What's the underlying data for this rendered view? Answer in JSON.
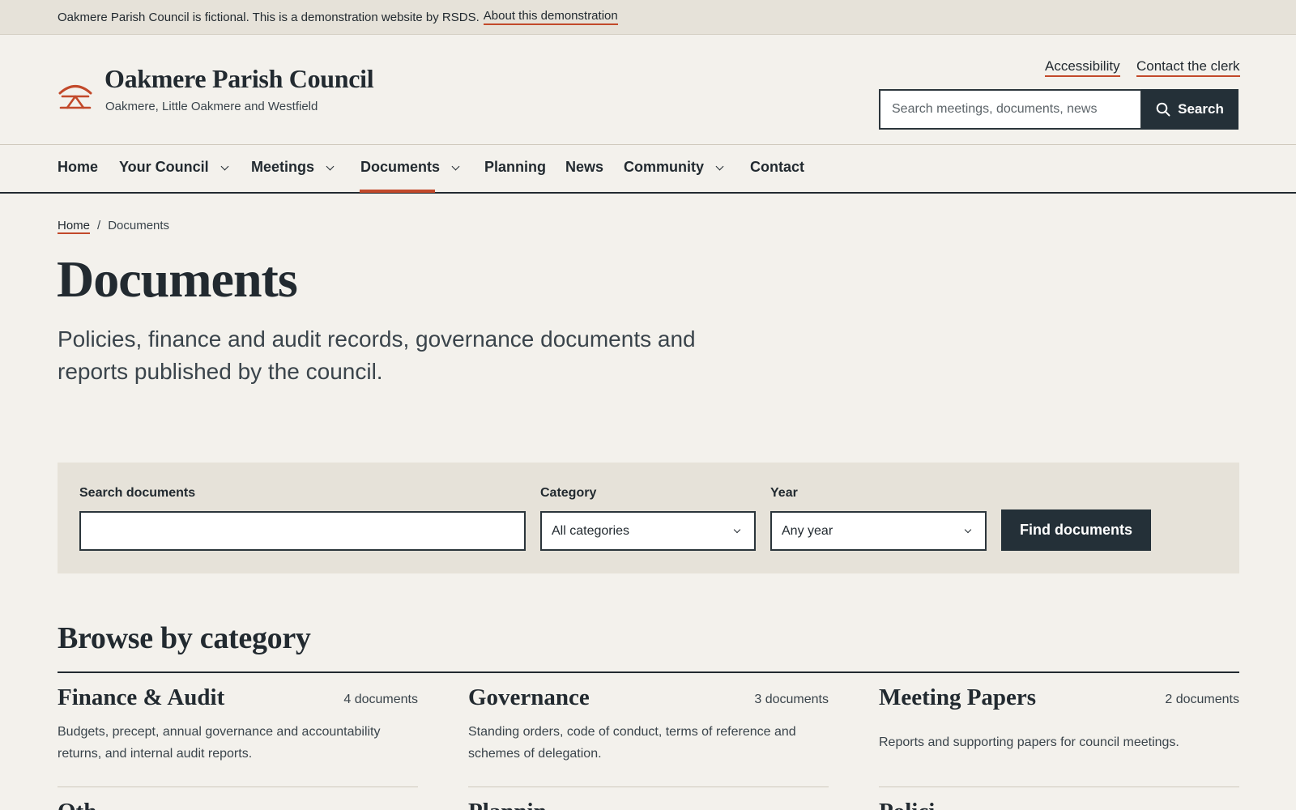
{
  "demo_bar": {
    "text": "Oakmere Parish Council is fictional. This is a demonstration website by RSDS.",
    "link": "About this demonstration"
  },
  "header": {
    "logo_icon": "oak-arch-icon",
    "title": "Oakmere Parish Council",
    "subtitle": "Oakmere, Little Oakmere and Westfield",
    "utility_links": [
      "Accessibility",
      "Contact the clerk"
    ],
    "search_placeholder": "Search meetings, documents, news",
    "search_button": "Search"
  },
  "nav": {
    "items": [
      {
        "label": "Home",
        "dropdown": false
      },
      {
        "label": "Your Council",
        "dropdown": true
      },
      {
        "label": "Meetings",
        "dropdown": true
      },
      {
        "label": "Documents",
        "dropdown": true,
        "active": true
      },
      {
        "label": "Planning",
        "dropdown": false
      },
      {
        "label": "News",
        "dropdown": false
      },
      {
        "label": "Community",
        "dropdown": true
      },
      {
        "label": "Contact",
        "dropdown": false
      }
    ]
  },
  "breadcrumb": {
    "home": "Home",
    "separator": "/",
    "current": "Documents"
  },
  "page": {
    "title": "Documents",
    "lead": "Policies, finance and audit records, governance documents and reports published by the council."
  },
  "filter": {
    "search_label": "Search documents",
    "search_value": "",
    "category_label": "Category",
    "category_value": "All categories",
    "year_label": "Year",
    "year_value": "Any year",
    "submit": "Find documents"
  },
  "browse": {
    "title": "Browse by category",
    "categories": [
      {
        "name": "Finance & Audit",
        "count": "4 documents",
        "description": "Budgets, precept, annual governance and accountability returns, and internal audit reports."
      },
      {
        "name": "Governance",
        "count": "3 documents",
        "description": "Standing orders, code of conduct, terms of reference and schemes of delegation."
      },
      {
        "name": "Meeting Papers",
        "count": "2 documents",
        "description": "Reports and supporting papers for council meetings."
      }
    ],
    "next_row_partial": [
      "Oth",
      "Plannin",
      "Polici"
    ]
  },
  "colors": {
    "accent": "#c2492a",
    "dark": "#243038",
    "background": "#f3f1ec",
    "panel": "#e6e2d9"
  }
}
